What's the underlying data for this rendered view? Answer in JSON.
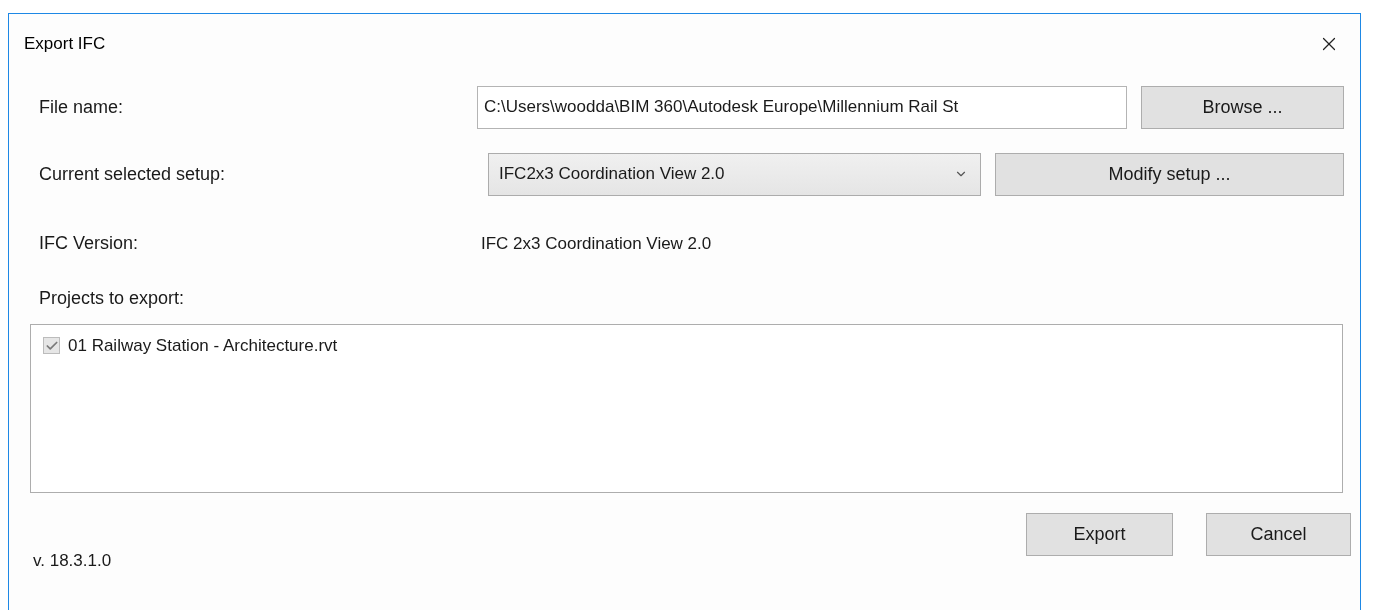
{
  "window": {
    "title": "Export IFC"
  },
  "file_name": {
    "label": "File name:",
    "value": "C:\\Users\\woodda\\BIM 360\\Autodesk Europe\\Millennium Rail St",
    "button": "Browse ..."
  },
  "setup": {
    "label": "Current selected setup:",
    "value": "IFC2x3 Coordination View 2.0",
    "button": "Modify setup ..."
  },
  "ifc_version": {
    "label": "IFC Version:",
    "value": "IFC 2x3 Coordination View 2.0"
  },
  "projects": {
    "label": "Projects to export:",
    "items": [
      {
        "label": "01 Railway Station - Architecture.rvt",
        "checked": true,
        "disabled": true
      }
    ]
  },
  "version": "v. 18.3.1.0",
  "buttons": [
    "Export",
    "Cancel"
  ]
}
